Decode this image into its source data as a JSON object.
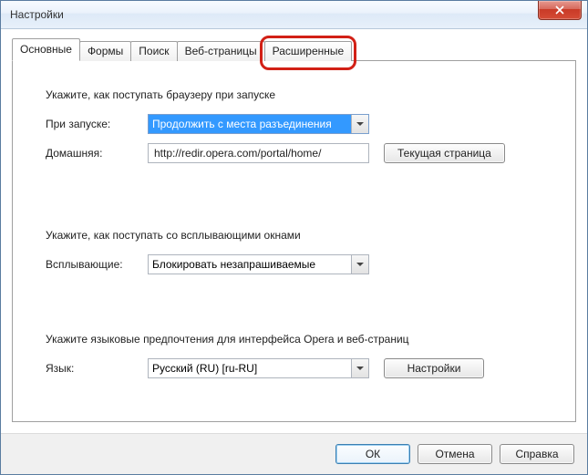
{
  "window": {
    "title": "Настройки"
  },
  "tabs": [
    {
      "label": "Основные",
      "active": true
    },
    {
      "label": "Формы"
    },
    {
      "label": "Поиск"
    },
    {
      "label": "Веб-страницы"
    },
    {
      "label": "Расширенные",
      "highlighted": true
    }
  ],
  "startup": {
    "heading": "Укажите, как поступать браузеру при запуске",
    "on_start_label": "При запуске:",
    "on_start_value": "Продолжить с места разъединения",
    "home_label": "Домашняя:",
    "home_value": "http://redir.opera.com/portal/home/",
    "current_page_btn": "Текущая страница"
  },
  "popups": {
    "heading": "Укажите, как поступать со всплывающими окнами",
    "label": "Всплывающие:",
    "value": "Блокировать незапрашиваемые"
  },
  "language": {
    "heading": "Укажите языковые предпочтения для интерфейса Opera и веб-страниц",
    "label": "Язык:",
    "value": "Русский (RU) [ru-RU]",
    "settings_btn": "Настройки"
  },
  "footer": {
    "ok": "ОК",
    "cancel": "Отмена",
    "help": "Справка"
  }
}
